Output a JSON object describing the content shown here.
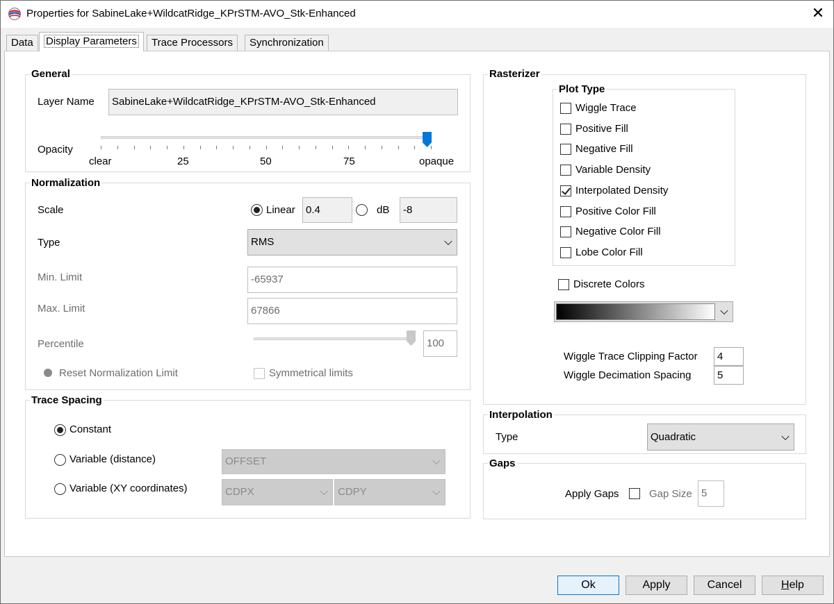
{
  "window": {
    "title": "Properties for SabineLake+WildcatRidge_KPrSTM-AVO_Stk-Enhanced",
    "close_glyph": "✕"
  },
  "tabs": [
    "Data",
    "Display Parameters",
    "Trace Processors",
    "Synchronization"
  ],
  "general": {
    "group_label": "General",
    "layer_name_label": "Layer Name",
    "layer_name_value": "SabineLake+WildcatRidge_KPrSTM-AVO_Stk-Enhanced",
    "opacity_label": "Opacity",
    "opacity_value": 1.0,
    "opacity_ticks": [
      "clear",
      "25",
      "50",
      "75",
      "opaque"
    ]
  },
  "normalization": {
    "group_label": "Normalization",
    "scale_label": "Scale",
    "linear_label": "Linear",
    "linear_value": "0.4",
    "db_label": "dB",
    "db_value": "-8",
    "type_label": "Type",
    "type_value": "RMS",
    "min_limit_label": "Min. Limit",
    "min_limit_value": "-65937",
    "max_limit_label": "Max. Limit",
    "max_limit_value": "67866",
    "percentile_label": "Percentile",
    "percentile_value": "100",
    "reset_label": "Reset Normalization Limit",
    "symmetrical_label": "Symmetrical limits"
  },
  "trace_spacing": {
    "group_label": "Trace Spacing",
    "constant_label": "Constant",
    "variable_distance_label": "Variable (distance)",
    "variable_distance_value": "OFFSET",
    "variable_xy_label": "Variable (XY coordinates)",
    "x_value": "CDPX",
    "y_value": "CDPY"
  },
  "rasterizer": {
    "group_label": "Rasterizer",
    "plot_type_label": "Plot Type",
    "plot_types": [
      {
        "label": "Wiggle Trace",
        "checked": false
      },
      {
        "label": "Positive Fill",
        "checked": false
      },
      {
        "label": "Negative Fill",
        "checked": false
      },
      {
        "label": "Variable Density",
        "checked": false
      },
      {
        "label": "Interpolated Density",
        "checked": true
      },
      {
        "label": "Positive Color Fill",
        "checked": false
      },
      {
        "label": "Negative Color Fill",
        "checked": false
      },
      {
        "label": "Lobe Color Fill",
        "checked": false
      }
    ],
    "discrete_colors_label": "Discrete Colors",
    "wiggle_clip_label": "Wiggle Trace Clipping Factor",
    "wiggle_clip_value": "4",
    "wiggle_decim_label": "Wiggle Decimation Spacing",
    "wiggle_decim_value": "5"
  },
  "interpolation": {
    "group_label": "Interpolation",
    "type_label": "Type",
    "type_value": "Quadratic"
  },
  "gaps": {
    "group_label": "Gaps",
    "apply_label": "Apply Gaps",
    "gap_size_label": "Gap Size",
    "gap_size_value": "5"
  },
  "buttons": {
    "ok": "Ok",
    "apply": "Apply",
    "cancel": "Cancel",
    "help_first": "H",
    "help_rest": "elp"
  }
}
